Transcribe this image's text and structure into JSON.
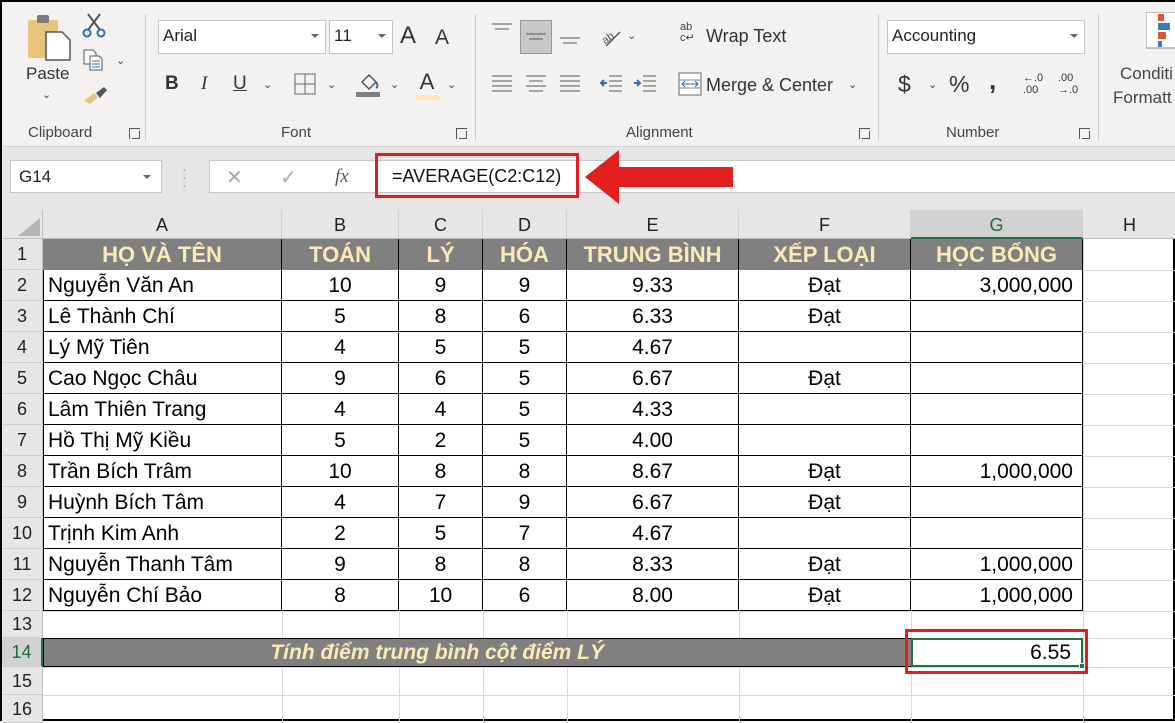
{
  "ribbon": {
    "clipboard": {
      "label": "Clipboard",
      "paste_label": "Paste"
    },
    "font": {
      "label": "Font",
      "font_name": "Arial",
      "font_size": "11",
      "bold": "B",
      "italic": "I",
      "underline": "U",
      "grow": "A",
      "shrink": "A",
      "font_color": "A"
    },
    "alignment": {
      "label": "Alignment",
      "wrap_text": "Wrap Text",
      "merge_center": "Merge & Center"
    },
    "number": {
      "label": "Number",
      "format": "Accounting",
      "currency": "$",
      "percent": "%",
      "comma": ",",
      "inc_decimal": "←.0 .00",
      "dec_decimal": ".00 →.0"
    },
    "styles": {
      "conditional_line1": "Conditi",
      "conditional_line2": "Formatt"
    }
  },
  "formula_bar": {
    "name_box": "G14",
    "cancel": "✕",
    "enter": "✓",
    "fx": "fx",
    "formula": "=AVERAGE(C2:C12)"
  },
  "columns": [
    "A",
    "B",
    "C",
    "D",
    "E",
    "F",
    "G",
    "H"
  ],
  "selected_column": "G",
  "rows": [
    "1",
    "2",
    "3",
    "4",
    "5",
    "6",
    "7",
    "8",
    "9",
    "10",
    "11",
    "12",
    "13",
    "14",
    "15",
    "16"
  ],
  "selected_row": "14",
  "table": {
    "headers": [
      "HỌ VÀ TÊN",
      "TOÁN",
      "LÝ",
      "HÓA",
      "TRUNG BÌNH",
      "XẾP LOẠI",
      "HỌC BỔNG"
    ],
    "records": [
      {
        "name": "Nguyễn Văn An",
        "toan": "10",
        "ly": "9",
        "hoa": "9",
        "tb": "9.33",
        "xl": "Đạt",
        "hb": "3,000,000"
      },
      {
        "name": "Lê Thành Chí",
        "toan": "5",
        "ly": "8",
        "hoa": "6",
        "tb": "6.33",
        "xl": "Đạt",
        "hb": ""
      },
      {
        "name": "Lý Mỹ Tiên",
        "toan": "4",
        "ly": "5",
        "hoa": "5",
        "tb": "4.67",
        "xl": "",
        "hb": ""
      },
      {
        "name": "Cao Ngọc Châu",
        "toan": "9",
        "ly": "6",
        "hoa": "5",
        "tb": "6.67",
        "xl": "Đạt",
        "hb": ""
      },
      {
        "name": "Lâm Thiên Trang",
        "toan": "4",
        "ly": "4",
        "hoa": "5",
        "tb": "4.33",
        "xl": "",
        "hb": ""
      },
      {
        "name": "Hồ Thị Mỹ Kiều",
        "toan": "5",
        "ly": "2",
        "hoa": "5",
        "tb": "4.00",
        "xl": "",
        "hb": ""
      },
      {
        "name": "Trần Bích Trâm",
        "toan": "10",
        "ly": "8",
        "hoa": "8",
        "tb": "8.67",
        "xl": "Đạt",
        "hb": "1,000,000"
      },
      {
        "name": "Huỳnh Bích Tâm",
        "toan": "4",
        "ly": "7",
        "hoa": "9",
        "tb": "6.67",
        "xl": "Đạt",
        "hb": ""
      },
      {
        "name": "Trịnh Kim Anh",
        "toan": "2",
        "ly": "5",
        "hoa": "7",
        "tb": "4.67",
        "xl": "",
        "hb": ""
      },
      {
        "name": "Nguyễn Thanh Tâm",
        "toan": "9",
        "ly": "8",
        "hoa": "8",
        "tb": "8.33",
        "xl": "Đạt",
        "hb": "1,000,000"
      },
      {
        "name": "Nguyễn Chí Bảo",
        "toan": "8",
        "ly": "10",
        "hoa": "6",
        "tb": "8.00",
        "xl": "Đạt",
        "hb": "1,000,000"
      }
    ],
    "summary_label": "Tính điểm trung bình cột điểm LÝ",
    "summary_value": "6.55"
  },
  "colors": {
    "header_fill": "#808080",
    "header_text": "#fce9b6",
    "highlight": "#e31e1e",
    "selection": "#217346"
  }
}
